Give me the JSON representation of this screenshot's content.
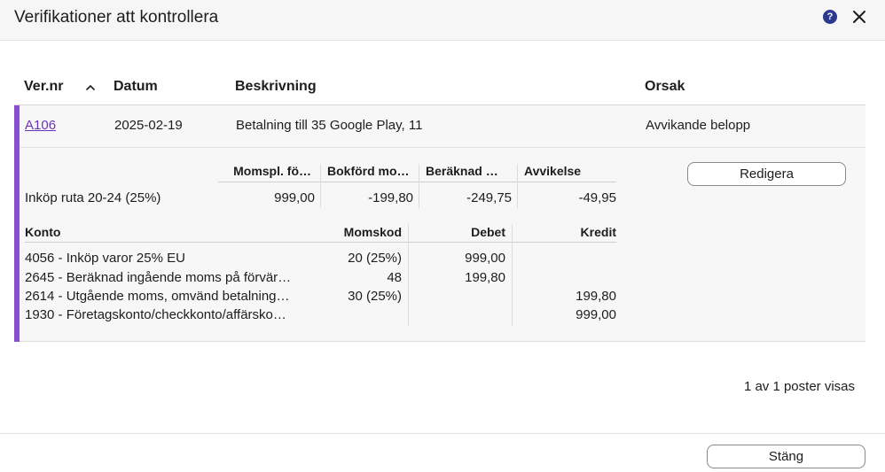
{
  "dialog": {
    "title": "Verifikationer att kontrollera",
    "help_icon": "question-circle-icon",
    "close_icon": "close-x-icon",
    "help_glyph": "?"
  },
  "table": {
    "columns": [
      "Ver.nr",
      "Datum",
      "Beskrivning",
      "Orsak"
    ],
    "sort_icon": "chevron-up-icon",
    "row": {
      "vernr": "A106",
      "datum": "2025-02-19",
      "beskrivning": "Betalning till 35 Google Play, 11",
      "orsak": "Avvikande belopp"
    }
  },
  "detail": {
    "vat_columns": [
      "Momspl. fö…",
      "Bokförd mo…",
      "Beräknad …",
      "Avvikelse"
    ],
    "vat_row": {
      "label": "Inköp ruta 20-24 (25%)",
      "values": [
        "999,00",
        "-199,80",
        "-249,75",
        "-49,95"
      ]
    },
    "edit_button": "Redigera",
    "account_columns": [
      "Konto",
      "Momskod",
      "Debet",
      "Kredit"
    ],
    "accounts": [
      {
        "konto": "4056 - Inköp varor 25% EU",
        "momskod": "20 (25%)",
        "debet": "999,00",
        "kredit": ""
      },
      {
        "konto": "2645 - Beräknad ingående moms på förvär…",
        "momskod": "48",
        "debet": "199,80",
        "kredit": ""
      },
      {
        "konto": "2614 - Utgående moms, omvänd betalning…",
        "momskod": "30 (25%)",
        "debet": "",
        "kredit": "199,80"
      },
      {
        "konto": "1930 - Företagskonto/checkkonto/affärsko…",
        "momskod": "",
        "debet": "",
        "kredit": "999,00"
      }
    ]
  },
  "footer": {
    "count_text": "1 av 1 poster visas",
    "close_button": "Stäng"
  },
  "colors": {
    "accent": "#8a4fd0",
    "link": "#6a35b5",
    "help": "#2b3a8f"
  }
}
